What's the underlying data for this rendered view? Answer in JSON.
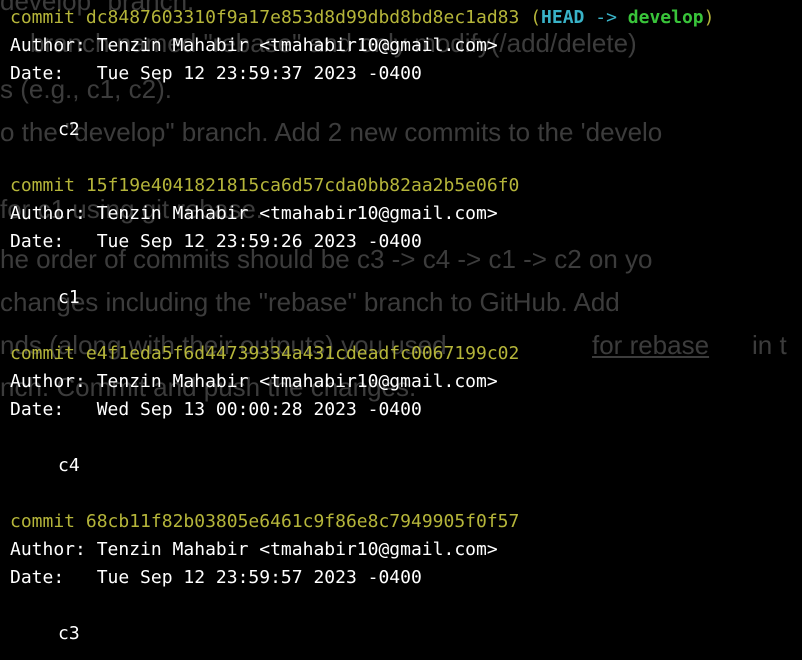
{
  "background_text": [
    "develop\" branch.",
    "branch named \"rebase\" and only modify(/add/delete)",
    "s (e.g., c1, c2).",
    "o the \"develop\" branch. Add 2 new commits to the 'develo",
    "for c1 using git rebase.",
    "he order of commits should be c3 -> c4 -> c1 -> c2 on yo",
    "changes including the \"rebase\" branch to GitHub. Add",
    "nds (along with their outputs) you used",
    "for rebase",
    "in t",
    "nch. Commit and push the changes."
  ],
  "commits": [
    {
      "label": "commit",
      "hash": "dc8487603310f9a17e853d8d99dbd8bd8ec1ad83",
      "refs": {
        "head": "HEAD",
        "arrow": "->",
        "branch": "develop"
      },
      "author_label": "Author:",
      "author": "Tenzin Mahabir <tmahabir10@gmail.com>",
      "date_label": "Date:",
      "date": "Tue Sep 12 23:59:37 2023 -0400",
      "message": "c2"
    },
    {
      "label": "commit",
      "hash": "15f19e4041821815ca6d57cda0bb82aa2b5e06f0",
      "author_label": "Author:",
      "author": "Tenzin Mahabir <tmahabir10@gmail.com>",
      "date_label": "Date:",
      "date": "Tue Sep 12 23:59:26 2023 -0400",
      "message": "c1"
    },
    {
      "label": "commit",
      "hash": "e4f1eda5f6d44739334a431cdeadfc0067199c02",
      "author_label": "Author:",
      "author": "Tenzin Mahabir <tmahabir10@gmail.com>",
      "date_label": "Date:",
      "date": "Wed Sep 13 00:00:28 2023 -0400",
      "message": "c4"
    },
    {
      "label": "commit",
      "hash": "68cb11f82b03805e6461c9f86e8c7949905f0f57",
      "author_label": "Author:",
      "author": "Tenzin Mahabir <tmahabir10@gmail.com>",
      "date_label": "Date:",
      "date": "Tue Sep 12 23:59:57 2023 -0400",
      "message": "c3"
    }
  ],
  "colors": {
    "background": "#000000",
    "commit_hash": "#b5b53a",
    "head_ref": "#39b3c8",
    "branch_ref": "#39c43a",
    "text": "#ffffff",
    "ghost_text": "#3c3c3c"
  }
}
